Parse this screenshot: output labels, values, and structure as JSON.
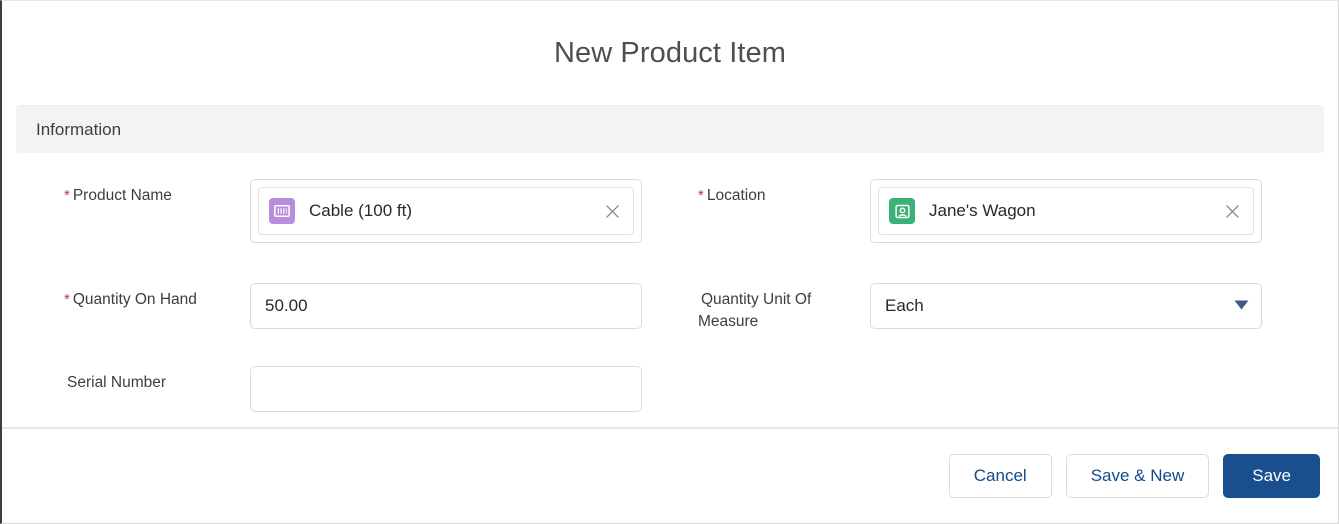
{
  "modal": {
    "title": "New Product Item"
  },
  "section": {
    "title": "Information"
  },
  "fields": {
    "product_name": {
      "label": "Product Name",
      "required_marker": "*",
      "value": "Cable (100 ft)",
      "icon": "product-icon",
      "icon_color": "#b88ddc",
      "clear_icon": "close-icon"
    },
    "location": {
      "label": "Location",
      "required_marker": "*",
      "value": "Jane's Wagon",
      "icon": "location-icon",
      "icon_color": "#3bb077",
      "clear_icon": "close-icon"
    },
    "quantity_on_hand": {
      "label": "Quantity On Hand",
      "required_marker": "*",
      "value": "50.00",
      "placeholder": ""
    },
    "quantity_unit_of_measure": {
      "label": "Quantity Unit Of Measure",
      "required_marker": "",
      "value": "Each",
      "dropdown_icon": "chevron-down-icon",
      "options": [
        "Each"
      ]
    },
    "serial_number": {
      "label": "Serial Number",
      "required_marker": "",
      "value": "",
      "placeholder": ""
    }
  },
  "footer": {
    "cancel_label": "Cancel",
    "save_new_label": "Save & New",
    "save_label": "Save"
  },
  "colors": {
    "required_asterisk": "#c23934",
    "brand_blue": "#194e8f",
    "link_blue": "#0f4c8c",
    "section_band": "#f3f3f3",
    "border": "#dddbda"
  }
}
